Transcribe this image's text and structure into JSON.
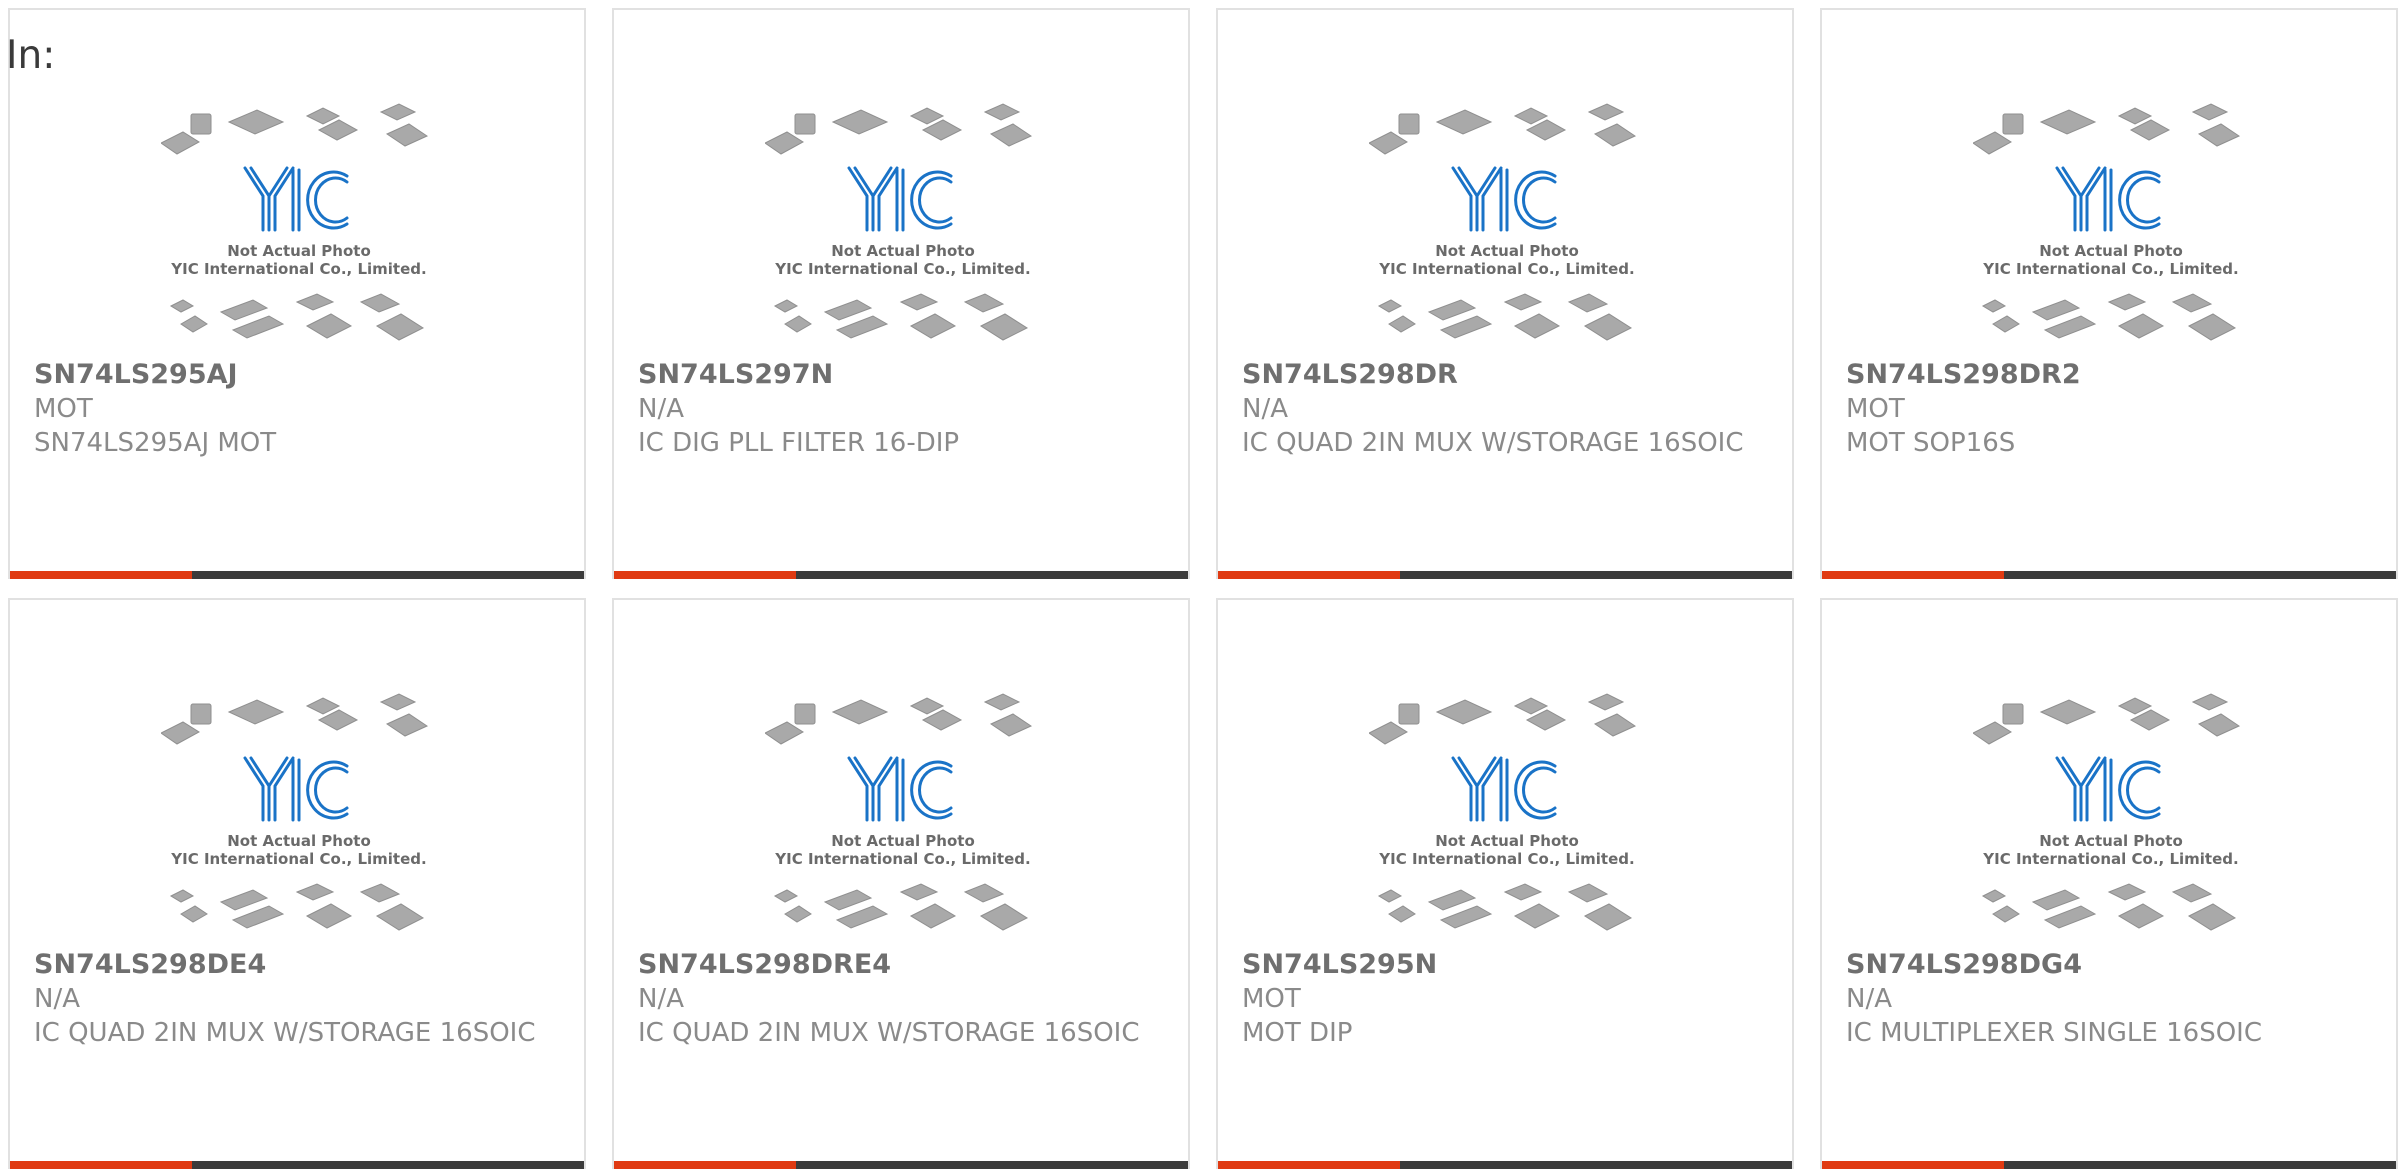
{
  "header": {
    "label": "In:"
  },
  "thumbnail": {
    "brand": "YIC",
    "caption_line1": "Not Actual Photo",
    "caption_line2": "YIC International Co., Limited."
  },
  "colors": {
    "accent": "#e03a12",
    "bar": "#3b3b3b",
    "logo": "#1a73c7"
  },
  "products": [
    {
      "part": "SN74LS295AJ",
      "maker": "MOT",
      "desc": "SN74LS295AJ MOT"
    },
    {
      "part": "SN74LS297N",
      "maker": "N/A",
      "desc": "IC DIG PLL FILTER 16-DIP"
    },
    {
      "part": "SN74LS298DR",
      "maker": "N/A",
      "desc": "IC QUAD 2IN MUX W/STORAGE 16SOIC"
    },
    {
      "part": "SN74LS298DR2",
      "maker": "MOT",
      "desc": "MOT SOP16S"
    },
    {
      "part": "SN74LS298DE4",
      "maker": "N/A",
      "desc": "IC QUAD 2IN MUX W/STORAGE 16SOIC"
    },
    {
      "part": "SN74LS298DRE4",
      "maker": "N/A",
      "desc": "IC QUAD 2IN MUX W/STORAGE 16SOIC"
    },
    {
      "part": "SN74LS295N",
      "maker": "MOT",
      "desc": "MOT DIP"
    },
    {
      "part": "SN74LS298DG4",
      "maker": "N/A",
      "desc": "IC MULTIPLEXER SINGLE 16SOIC"
    }
  ]
}
